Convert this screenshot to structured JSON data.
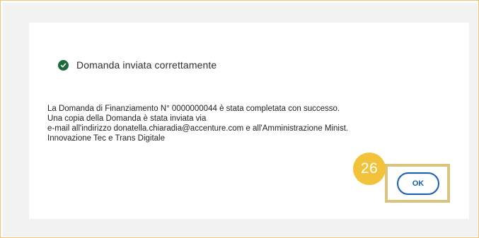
{
  "dialog": {
    "status": {
      "icon": "check-circle-icon",
      "text": "Domanda inviata correttamente",
      "color": "#1d6b3a"
    },
    "message_lines": [
      "La Domanda di Finanziamento N° 0000000044 è stata completata con successo.",
      "Una copia della Domanda è stata inviata via",
      "e-mail all'indirizzo donatella.chiaradia@accenture.com e all'Amministrazione Minist.",
      "Innovazione Tec e Trans Digitale"
    ],
    "ok_label": "OK"
  },
  "annotation": {
    "step_number": "26",
    "badge_color": "#f2c23a",
    "highlight_color": "#ddc47e"
  },
  "colors": {
    "accent": "#1b5fb3",
    "backdrop": "#f2f2f2",
    "frame_border": "#f3c27a"
  }
}
